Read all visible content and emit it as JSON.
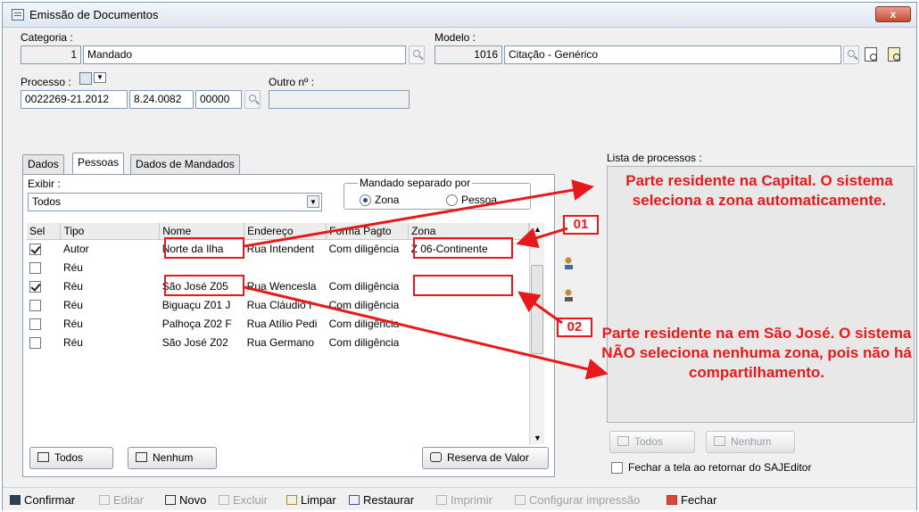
{
  "window": {
    "title": "Emissão de Documentos",
    "close_label": "x"
  },
  "categoria": {
    "label": "Categoria :",
    "code": "1",
    "name": "Mandado"
  },
  "modelo": {
    "label": "Modelo :",
    "code": "1016",
    "name": "Citação - Genérico"
  },
  "processo": {
    "label": "Processo :",
    "part1": "0022269-21.2012",
    "part2": "8.24.0082",
    "part3": "00000",
    "outro_label": "Outro nº :",
    "outro_value": ""
  },
  "tabs": [
    {
      "label": "Dados"
    },
    {
      "label": "Pessoas"
    },
    {
      "label": "Dados de Mandados"
    }
  ],
  "exibir": {
    "label": "Exibir :",
    "value": "Todos"
  },
  "mandado_separado": {
    "label": "Mandado separado por",
    "opt1": "Zona",
    "opt2": "Pessoa"
  },
  "grid": {
    "headers": [
      "Sel",
      "Tipo",
      "Nome",
      "Endereço",
      "Forma Pagto",
      "Zona"
    ],
    "rows": [
      {
        "checked": true,
        "tipo": "Autor",
        "nome": "Norte da Ilha",
        "endereco": "Rua Intendent",
        "forma": "Com diligência",
        "zona": "Z 06-Continente"
      },
      {
        "checked": false,
        "tipo": "Réu",
        "nome": "",
        "endereco": "",
        "forma": "",
        "zona": ""
      },
      {
        "checked": true,
        "tipo": "Réu",
        "nome": "São José Z05",
        "endereco": "Rua Wencesla",
        "forma": "Com diligência",
        "zona": ""
      },
      {
        "checked": false,
        "tipo": "Réu",
        "nome": "Biguaçu Z01 J",
        "endereco": "Rua Cláudio I",
        "forma": "Com diligência",
        "zona": ""
      },
      {
        "checked": false,
        "tipo": "Réu",
        "nome": "Palhoça Z02 F",
        "endereco": "Rua Atílio Pedi",
        "forma": "Com diligência",
        "zona": ""
      },
      {
        "checked": false,
        "tipo": "Réu",
        "nome": "São José Z02",
        "endereco": "Rua Germano",
        "forma": "Com diligência",
        "zona": ""
      }
    ]
  },
  "buttons": {
    "todos": "Todos",
    "nenhum": "Nenhum",
    "reserva": "Reserva de Valor",
    "todos2": "Todos",
    "nenhum2": "Nenhum"
  },
  "lista_processos": {
    "label": "Lista de processos :"
  },
  "fechar_check": {
    "label": "Fechar a tela ao retornar do SAJEditor"
  },
  "toolbar": {
    "confirmar": "Confirmar",
    "editar": "Editar",
    "novo": "Novo",
    "excluir": "Excluir",
    "limpar": "Limpar",
    "restaurar": "Restaurar",
    "imprimir": "Imprimir",
    "configurar": "Configurar impressão",
    "fechar": "Fechar"
  },
  "annotations": {
    "badge1": "01",
    "badge2": "02",
    "text1": "Parte residente na Capital. O sistema seleciona a zona automaticamente.",
    "text2": "Parte residente na em São José. O sistema NÃO seleciona nenhuma zona, pois não há compartilhamento."
  },
  "colors": {
    "annotation_red": "#e8191b",
    "window_border": "#7f9db9"
  }
}
